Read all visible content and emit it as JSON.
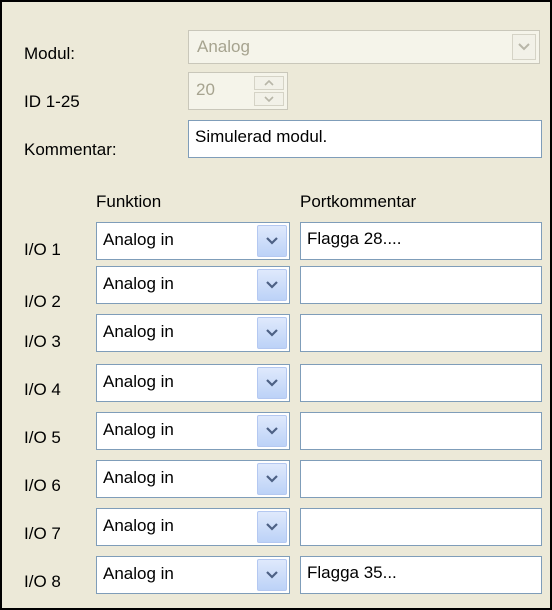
{
  "module": {
    "label": "Modul:",
    "value": "Analog"
  },
  "id": {
    "label": "ID 1-25",
    "value": "20"
  },
  "comment": {
    "label": "Kommentar:",
    "value": "Simulerad modul."
  },
  "columns": {
    "function": "Funktion",
    "port_comment": "Portkommentar"
  },
  "io_rows": [
    {
      "label": "I/O 1",
      "function": "Analog in",
      "comment": "Flagga 28...."
    },
    {
      "label": "I/O 2",
      "function": "Analog in",
      "comment": ""
    },
    {
      "label": "I/O 3",
      "function": "Analog in",
      "comment": ""
    },
    {
      "label": "I/O 4",
      "function": "Analog in",
      "comment": ""
    },
    {
      "label": "I/O 5",
      "function": "Analog in",
      "comment": ""
    },
    {
      "label": "I/O 6",
      "function": "Analog in",
      "comment": ""
    },
    {
      "label": "I/O 7",
      "function": "Analog in",
      "comment": ""
    },
    {
      "label": "I/O 8",
      "function": "Analog in",
      "comment": "Flagga 35..."
    }
  ],
  "icons": {
    "dropdown": "chevron-down-icon",
    "spin_up": "arrow-up-icon",
    "spin_down": "arrow-down-icon"
  },
  "colors": {
    "panel": "#ece9d8",
    "field_border": "#7f9db9",
    "disabled_text": "#a6a38f",
    "dropdown_button": "#bcd2f7"
  }
}
